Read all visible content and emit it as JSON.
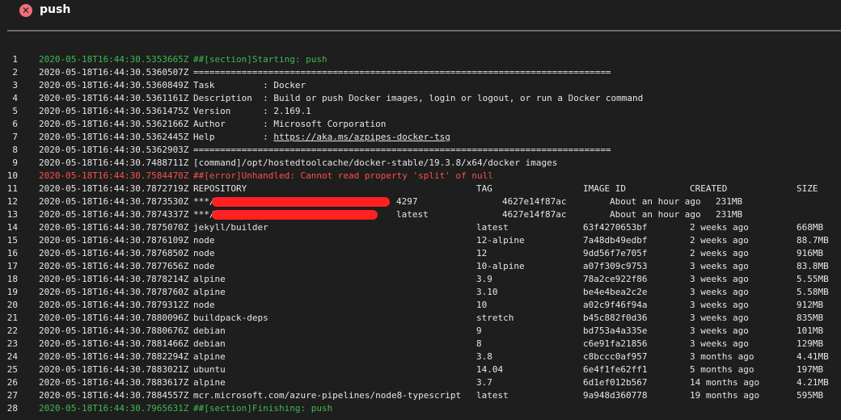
{
  "header": {
    "status_icon": "error-x-icon",
    "title": "push"
  },
  "lines": [
    {
      "n": "1",
      "ts": "2020-05-18T16:44:30.5353665Z",
      "msg": "##[section]Starting: push",
      "style": "green"
    },
    {
      "n": "2",
      "ts": "2020-05-18T16:44:30.5360507Z",
      "msg": "=============================================================================="
    },
    {
      "n": "3",
      "ts": "2020-05-18T16:44:30.5360849Z",
      "msg": "Task         : Docker"
    },
    {
      "n": "4",
      "ts": "2020-05-18T16:44:30.5361161Z",
      "msg": "Description  : Build or push Docker images, login or logout, or run a Docker command"
    },
    {
      "n": "5",
      "ts": "2020-05-18T16:44:30.5361475Z",
      "msg": "Version      : 2.169.1"
    },
    {
      "n": "6",
      "ts": "2020-05-18T16:44:30.5362166Z",
      "msg": "Author       : Microsoft Corporation"
    },
    {
      "n": "7",
      "ts": "2020-05-18T16:44:30.5362445Z",
      "msg": "Help         : ",
      "link": "https://aka.ms/azpipes-docker-tsg"
    },
    {
      "n": "8",
      "ts": "2020-05-18T16:44:30.5362903Z",
      "msg": "=============================================================================="
    },
    {
      "n": "9",
      "ts": "2020-05-18T16:44:30.7488711Z",
      "msg": "[command]/opt/hostedtoolcache/docker-stable/19.3.8/x64/docker images"
    },
    {
      "n": "10",
      "ts": "2020-05-18T16:44:30.7584470Z",
      "msg": "##[error]Unhandled: Cannot read property 'split' of null",
      "style": "red"
    }
  ],
  "table": {
    "headers": {
      "repository": "REPOSITORY",
      "tag": "TAG",
      "image_id": "IMAGE ID",
      "created": "CREATED",
      "size": "SIZE"
    },
    "header_line": {
      "n": "11",
      "ts": "2020-05-18T16:44:30.7872719Z"
    },
    "redacted_rows": [
      {
        "n": "12",
        "ts": "2020-05-18T16:44:30.7873530Z",
        "repo_prefix": "***/",
        "tag": "4297",
        "image_id": "4627e14f87ac",
        "created": "About an hour ago",
        "size": "231MB"
      },
      {
        "n": "13",
        "ts": "2020-05-18T16:44:30.7874337Z",
        "repo_prefix": "***/",
        "tag": "latest",
        "image_id": "4627e14f87ac",
        "created": "About an hour ago",
        "size": "231MB"
      }
    ],
    "rows": [
      {
        "n": "14",
        "ts": "2020-05-18T16:44:30.7875070Z",
        "repository": "jekyll/builder",
        "tag": "latest",
        "image_id": "63f4270653bf",
        "created": "2 weeks ago",
        "size": "668MB"
      },
      {
        "n": "15",
        "ts": "2020-05-18T16:44:30.7876109Z",
        "repository": "node",
        "tag": "12-alpine",
        "image_id": "7a48db49edbf",
        "created": "2 weeks ago",
        "size": "88.7MB"
      },
      {
        "n": "16",
        "ts": "2020-05-18T16:44:30.7876850Z",
        "repository": "node",
        "tag": "12",
        "image_id": "9dd56f7e705f",
        "created": "2 weeks ago",
        "size": "916MB"
      },
      {
        "n": "17",
        "ts": "2020-05-18T16:44:30.7877656Z",
        "repository": "node",
        "tag": "10-alpine",
        "image_id": "a07f309c9753",
        "created": "3 weeks ago",
        "size": "83.8MB"
      },
      {
        "n": "18",
        "ts": "2020-05-18T16:44:30.7878214Z",
        "repository": "alpine",
        "tag": "3.9",
        "image_id": "78a2ce922f86",
        "created": "3 weeks ago",
        "size": "5.55MB"
      },
      {
        "n": "19",
        "ts": "2020-05-18T16:44:30.7878760Z",
        "repository": "alpine",
        "tag": "3.10",
        "image_id": "be4e4bea2c2e",
        "created": "3 weeks ago",
        "size": "5.58MB"
      },
      {
        "n": "20",
        "ts": "2020-05-18T16:44:30.7879312Z",
        "repository": "node",
        "tag": "10",
        "image_id": "a02c9f46f94a",
        "created": "3 weeks ago",
        "size": "912MB"
      },
      {
        "n": "21",
        "ts": "2020-05-18T16:44:30.7880096Z",
        "repository": "buildpack-deps",
        "tag": "stretch",
        "image_id": "b45c882f0d36",
        "created": "3 weeks ago",
        "size": "835MB"
      },
      {
        "n": "22",
        "ts": "2020-05-18T16:44:30.7880676Z",
        "repository": "debian",
        "tag": "9",
        "image_id": "bd753a4a335e",
        "created": "3 weeks ago",
        "size": "101MB"
      },
      {
        "n": "23",
        "ts": "2020-05-18T16:44:30.7881466Z",
        "repository": "debian",
        "tag": "8",
        "image_id": "c6e91fa21856",
        "created": "3 weeks ago",
        "size": "129MB"
      },
      {
        "n": "24",
        "ts": "2020-05-18T16:44:30.7882294Z",
        "repository": "alpine",
        "tag": "3.8",
        "image_id": "c8bccc0af957",
        "created": "3 months ago",
        "size": "4.41MB"
      },
      {
        "n": "25",
        "ts": "2020-05-18T16:44:30.7883021Z",
        "repository": "ubuntu",
        "tag": "14.04",
        "image_id": "6e4f1fe62ff1",
        "created": "5 months ago",
        "size": "197MB"
      },
      {
        "n": "26",
        "ts": "2020-05-18T16:44:30.7883617Z",
        "repository": "alpine",
        "tag": "3.7",
        "image_id": "6d1ef012b567",
        "created": "14 months ago",
        "size": "4.21MB"
      },
      {
        "n": "27",
        "ts": "2020-05-18T16:44:30.7884557Z",
        "repository": "mcr.microsoft.com/azure-pipelines/node8-typescript",
        "tag": "latest",
        "image_id": "9a948d360778",
        "created": "19 months ago",
        "size": "595MB"
      }
    ]
  },
  "footer_line": {
    "n": "28",
    "ts": "2020-05-18T16:44:30.7965631Z",
    "msg": "##[section]Finishing: push",
    "style": "green"
  },
  "colors": {
    "section": "#3fb950",
    "error": "#f85149",
    "redaction": "#ff2020",
    "error_icon": "#f1707b"
  }
}
